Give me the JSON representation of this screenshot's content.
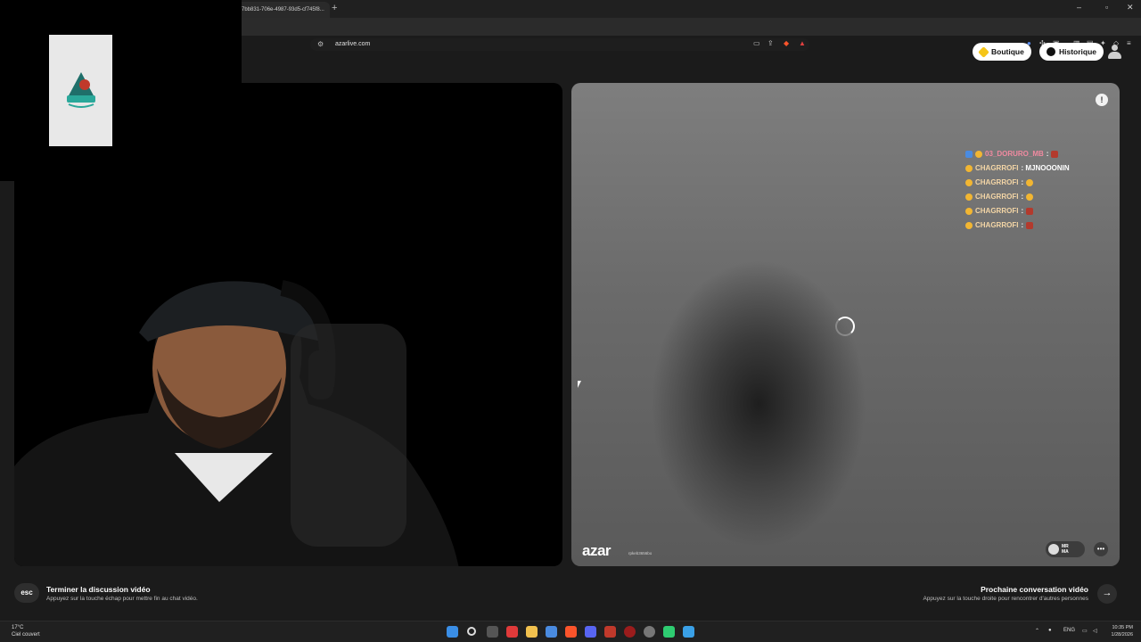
{
  "browser": {
    "tab_title": "7bb831-706e-4987-93d5-cf745f8...",
    "new_tab": "+",
    "url": "azarlive.com",
    "window_controls": [
      "–",
      "▫",
      "✕"
    ]
  },
  "header": {
    "shop_label": "Boutique",
    "history_label": "Historique",
    "icons": [
      "diamond-icon",
      "clock-icon",
      "user-icon"
    ]
  },
  "remote": {
    "chat": [
      {
        "name": "03_DORURO_MB",
        "msg": ":",
        "style": "pink"
      },
      {
        "name": "CHAGRROFI",
        "msg": ": MJNOOONIN",
        "style": "normal"
      },
      {
        "name": "CHAGRROFI",
        "msg": ":",
        "style": "normal"
      },
      {
        "name": "CHAGRROFI",
        "msg": ":",
        "style": "normal"
      },
      {
        "name": "CHAGRROFI",
        "msg": ":",
        "style": "normal"
      },
      {
        "name": "CHAGRROFI",
        "msg": ":",
        "style": "normal"
      }
    ],
    "brand": "azar",
    "brand_sub": "rpkeb3656bo",
    "country_codes": [
      "MR",
      "MA"
    ],
    "report_label": "!"
  },
  "bottom": {
    "esc_label": "esc",
    "end_title": "Terminer la discussion vidéo",
    "end_sub": "Appuyez sur la touche échap pour mettre fin au chat vidéo.",
    "next_title": "Prochaine conversation vidéo",
    "next_sub": "Appuyez sur la touche droite pour rencontrer d'autres personnes",
    "next_arrow": "→"
  },
  "taskbar": {
    "temp": "17°C",
    "weather": "Ciel couvert",
    "lang": "ENG",
    "time": "10:35 PM",
    "date": "1/28/2026"
  },
  "colors": {
    "accent_gold": "#f5c518",
    "chat_pink": "#f08aa0",
    "chat_name": "#f4d6a6"
  }
}
